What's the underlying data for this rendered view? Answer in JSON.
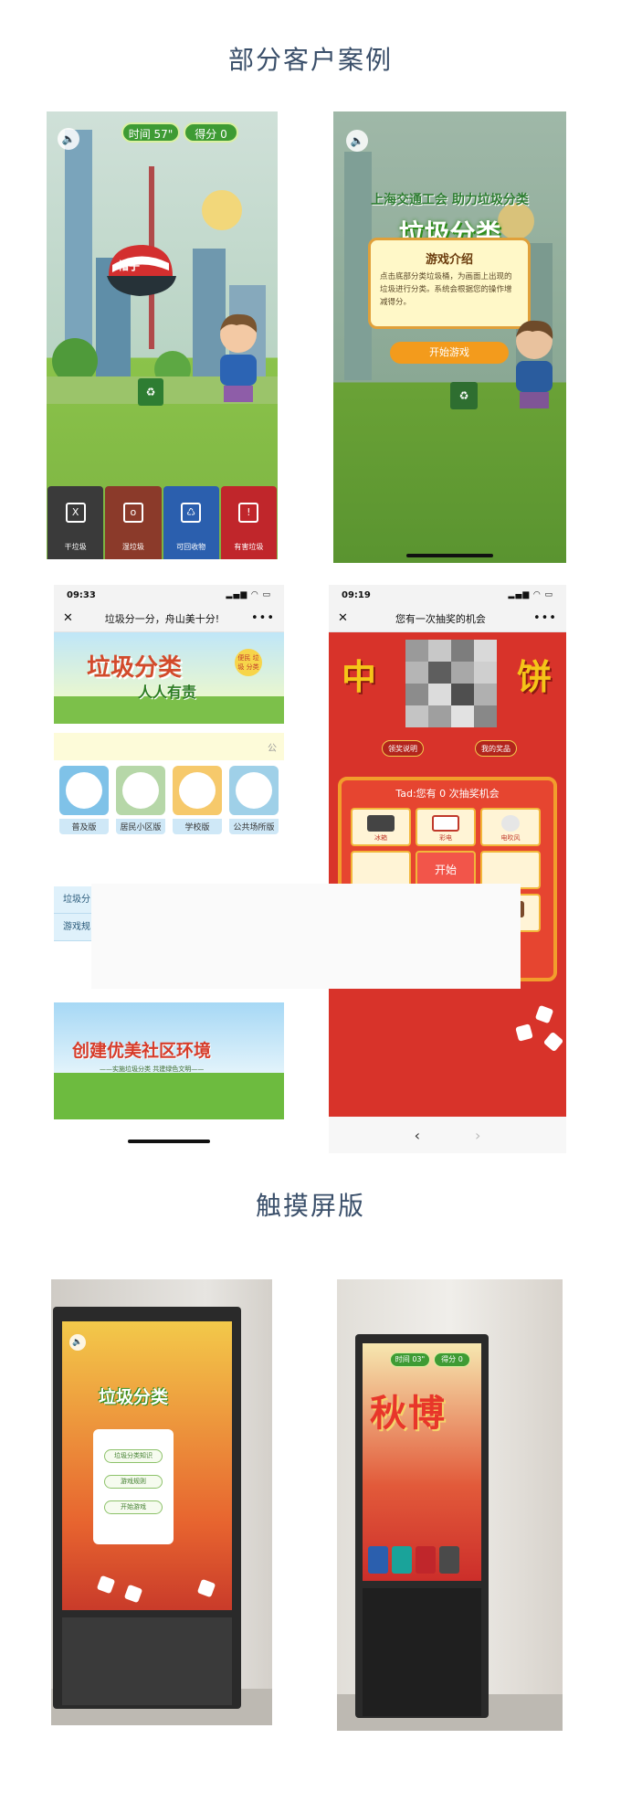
{
  "sections": {
    "cases_title": "部分客户案例",
    "touch_title": "触摸屏版"
  },
  "game1": {
    "time_label": "时间 57\"",
    "score_label": "得分 0",
    "hat_label": "帽子",
    "bins": [
      {
        "label": "干垃圾",
        "color": "#3a3a3a",
        "icon": "X"
      },
      {
        "label": "湿垃圾",
        "color": "#8b3a2a",
        "icon": "o"
      },
      {
        "label": "可回收物",
        "color": "#2b5fae",
        "icon": "♺"
      },
      {
        "label": "有害垃圾",
        "color": "#c0262b",
        "icon": "!"
      }
    ]
  },
  "game2": {
    "top_line": "上海交通工会 助力垃圾分类",
    "logo": "垃圾分类",
    "intro_title": "游戏介绍",
    "intro_text": "点击底部分类垃圾桶，为画面上出现的垃圾进行分类。系统会根据您的操作增减得分。",
    "start_button": "开始游戏"
  },
  "phone1": {
    "time": "09:33",
    "title": "垃圾分一分，舟山美十分!",
    "banner_title": "垃圾分类",
    "banner_sub": "人人有责",
    "badge": "便民 垃圾 分类",
    "notice_char": "公",
    "tiles": [
      {
        "label": "普及版",
        "color": "#7fc2e8"
      },
      {
        "label": "居民小区版",
        "color": "#b6d7a8"
      },
      {
        "label": "学校版",
        "color": "#f6c96b"
      },
      {
        "label": "公共场所版",
        "color": "#9fd0e8"
      }
    ],
    "list": [
      "垃圾分",
      "游戏规"
    ],
    "banner2_title": "创建优美社区环境",
    "banner2_sub": "——实施垃圾分类 共建绿色文明——"
  },
  "phone2": {
    "time": "09:19",
    "title": "您有一次抽奖的机会",
    "big_left": "中",
    "big_right": "饼",
    "tab_left": "领奖说明",
    "tab_right": "我的奖品",
    "board_head": "Tad:您有 0 次抽奖机会",
    "cells": [
      {
        "label": "冰箱"
      },
      {
        "label": "彩电"
      },
      {
        "label": "电吹风"
      },
      {
        "label": ""
      },
      {
        "label": "开始"
      },
      {
        "label": ""
      },
      {
        "label": ""
      },
      {
        "label": ""
      },
      {
        "label": "手机"
      }
    ]
  },
  "kiosk1": {
    "logo": "垃圾分类",
    "menu": [
      "垃圾分类知识",
      "游戏规则",
      "开始游戏"
    ]
  },
  "kiosk2": {
    "time_label": "时间 03\"",
    "score_label": "得分 0",
    "title": "秋博"
  }
}
